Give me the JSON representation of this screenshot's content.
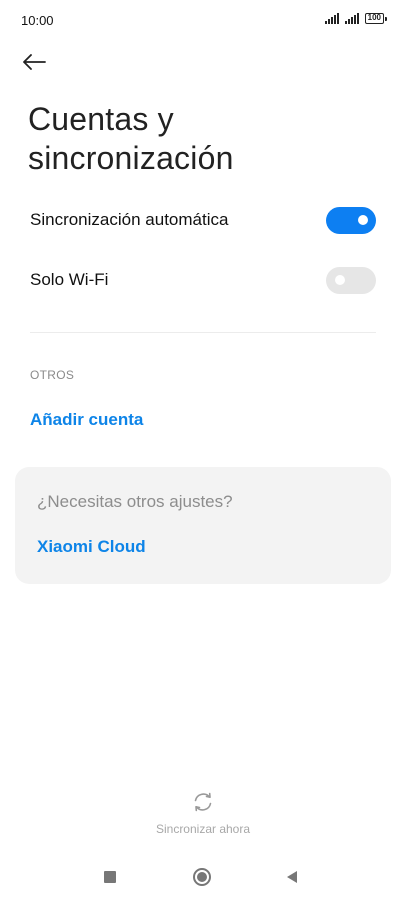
{
  "status_bar": {
    "time": "10:00",
    "battery": "100"
  },
  "header": {
    "back_icon": "arrow-left-icon",
    "title_line1": "Cuentas y",
    "title_line2": "sincronización"
  },
  "settings": {
    "auto_sync": {
      "label": "Sincronización automática",
      "enabled": true
    },
    "wifi_only": {
      "label": "Solo Wi-Fi",
      "enabled": false
    }
  },
  "others": {
    "header": "OTROS",
    "add_account": "Añadir cuenta"
  },
  "suggestion_card": {
    "title": "¿Necesitas otros ajustes?",
    "link": "Xiaomi Cloud"
  },
  "sync_now": {
    "icon": "sync-icon",
    "label": "Sincronizar ahora"
  },
  "nav_bar": {
    "recents_icon": "square-icon",
    "home_icon": "circle-icon",
    "back_icon": "triangle-back-icon"
  },
  "colors": {
    "accent": "#0d84e8",
    "toggle_on": "#0d7ff2",
    "toggle_off": "#e6e6e6",
    "card_bg": "#f3f3f3"
  }
}
